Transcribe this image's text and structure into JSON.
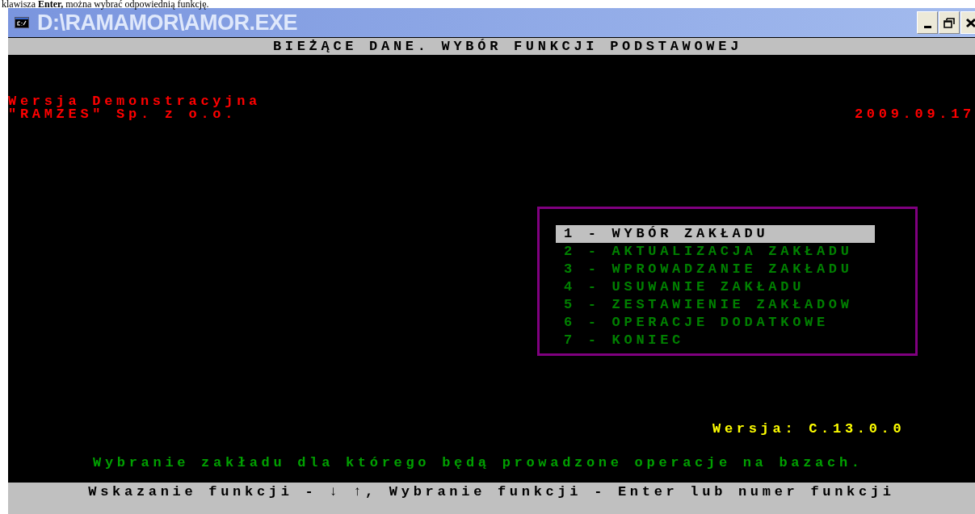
{
  "document_text": "klawisza **Enter,** można wybrać odpowiednią funkcję.",
  "window": {
    "title": "D:\\RAMAMOR\\AMOR.EXE"
  },
  "header": "BIEŻĄCE DANE. WYBÓR FUNKCJI PODSTAWOWEJ",
  "info_lines": [
    "Wersja Demonstracyjna",
    "\"RAMZES\" Sp. z o.o."
  ],
  "date": "2009.09.17",
  "menu": [
    {
      "label": "1 - WYBÓR ZAKŁADU",
      "selected": true
    },
    {
      "label": "2 - AKTUALIZACJA ZAKŁADU",
      "selected": false
    },
    {
      "label": "3 - WPROWADZANIE ZAKŁADU",
      "selected": false
    },
    {
      "label": "4 - USUWANIE ZAKŁADU",
      "selected": false
    },
    {
      "label": "5 - ZESTAWIENIE ZAKŁADOW",
      "selected": false
    },
    {
      "label": "6 - OPERACJE DODATKOWE",
      "selected": false
    },
    {
      "label": "7 - KONIEC",
      "selected": false
    }
  ],
  "version": "Wersja: C.13.0.0",
  "description": "Wybranie zakładu dla którego będą prowadzone operacje na bazach.",
  "status_bar": "Wskazanie funkcji - ↓ ↑, Wybranie funkcji - Enter lub numer funkcji"
}
